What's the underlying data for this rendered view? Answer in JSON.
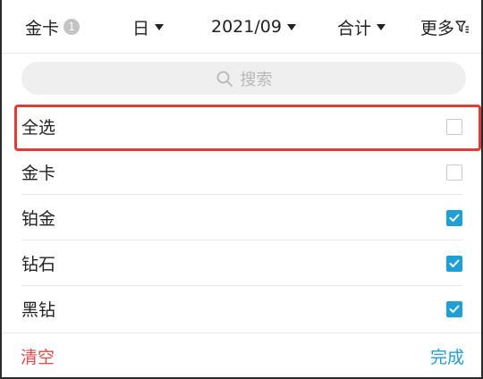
{
  "topbar": {
    "card_label": "金卡",
    "card_badge": "1",
    "day_label": "日",
    "month_label": "2021/09",
    "total_label": "合计",
    "more_label": "更多"
  },
  "search": {
    "placeholder": "搜索"
  },
  "list": {
    "items": [
      {
        "label": "全选",
        "checked": false,
        "highlighted": true
      },
      {
        "label": "金卡",
        "checked": false
      },
      {
        "label": "铂金",
        "checked": true
      },
      {
        "label": "钻石",
        "checked": true
      },
      {
        "label": "黑钻",
        "checked": true
      }
    ]
  },
  "footer": {
    "clear_label": "清空",
    "done_label": "完成"
  },
  "colors": {
    "accent": "#1e9fd6",
    "danger": "#e5484d",
    "highlight": "#e53935"
  }
}
